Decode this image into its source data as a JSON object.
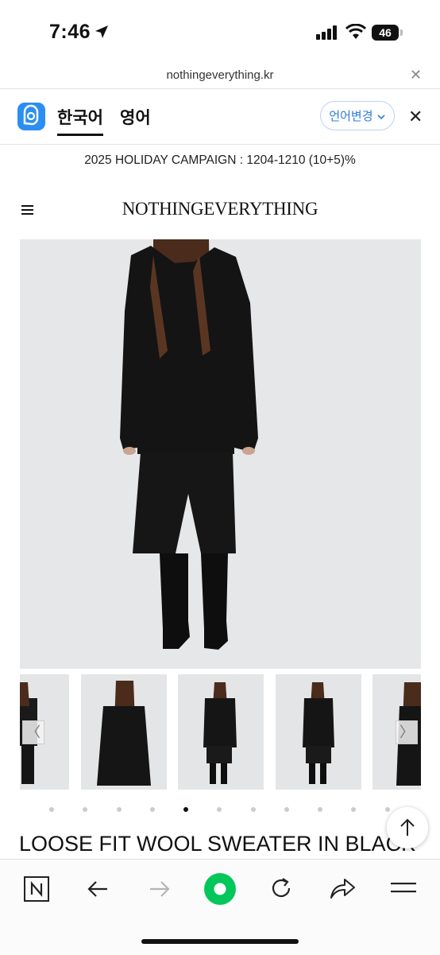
{
  "status_bar": {
    "time": "7:46",
    "battery": "46"
  },
  "browser": {
    "url": "nothingeverything.kr"
  },
  "translate_bar": {
    "lang_korean": "한국어",
    "lang_english": "영어",
    "change_language": "언어변경"
  },
  "site": {
    "campaign_banner": "2025 HOLIDAY CAMPAIGN : 1204-1210 (10+5)%",
    "brand": "NOTHINGEVERYTHING"
  },
  "product": {
    "title": "LOOSE FIT WOOL SWEATER IN BLACK",
    "thumbnail_count": 5,
    "carousel": {
      "dot_count": 11,
      "active_dot": 4
    }
  },
  "colors": {
    "accent_blue": "#2c8ef2",
    "naver_green": "#03c75a",
    "garment_black": "#111111"
  },
  "icons": [
    "location-arrow-icon",
    "signal-icon",
    "wifi-icon",
    "battery-icon",
    "close-icon",
    "papago-logo",
    "chevron-down-icon",
    "hamburger-menu-icon",
    "arrow-up-icon",
    "naver-n-icon",
    "back-arrow-icon",
    "forward-arrow-icon",
    "home-green-icon",
    "reload-icon",
    "share-icon",
    "menu-icon"
  ]
}
